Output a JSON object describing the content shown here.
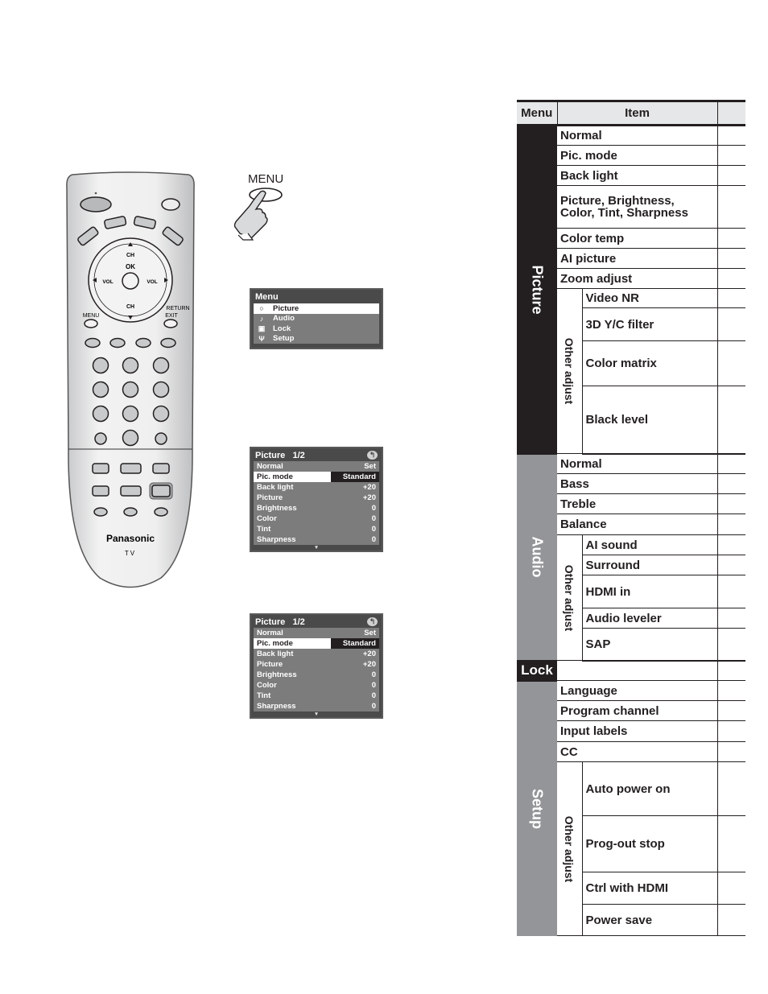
{
  "remote": {
    "brand": "Panasonic",
    "model_label": "TV",
    "buttons": {
      "ch_up": "CH",
      "ch_down": "CH",
      "ok": "OK",
      "vol_left": "VOL",
      "vol_right": "VOL",
      "menu": "MENU",
      "return_top": "RETURN",
      "return_bottom": "EXIT"
    }
  },
  "menu_press": {
    "label": "MENU",
    "icon": "hand-pressing-icon"
  },
  "osd_menu": {
    "title": "Menu",
    "items": [
      {
        "icon": "picture-icon",
        "glyph": "○",
        "label": "Picture",
        "selected": true
      },
      {
        "icon": "music-note-icon",
        "glyph": "♪",
        "label": "Audio",
        "selected": false
      },
      {
        "icon": "lock-icon",
        "glyph": "▣",
        "label": "Lock",
        "selected": false
      },
      {
        "icon": "wrench-icon",
        "glyph": "Ψ",
        "label": "Setup",
        "selected": false
      }
    ]
  },
  "osd_picture_1": {
    "title": "Picture",
    "page": "1/2",
    "return_icon": "↰",
    "rows": [
      {
        "label": "Normal",
        "value": "Set",
        "selected": false
      },
      {
        "label": "Pic. mode",
        "value": "Standard",
        "selected": true
      },
      {
        "label": "Back light",
        "value": "+20",
        "selected": false
      },
      {
        "label": "Picture",
        "value": "+20",
        "selected": false
      },
      {
        "label": "Brightness",
        "value": "0",
        "selected": false
      },
      {
        "label": "Color",
        "value": "0",
        "selected": false
      },
      {
        "label": "Tint",
        "value": "0",
        "selected": false
      },
      {
        "label": "Sharpness",
        "value": "0",
        "selected": false
      }
    ],
    "more_indicator": "▾"
  },
  "osd_picture_2": {
    "title": "Picture",
    "page": "1/2",
    "return_icon": "↰",
    "rows": [
      {
        "label": "Normal",
        "value": "Set",
        "selected": false
      },
      {
        "label": "Pic. mode",
        "value": "Standard",
        "selected": true
      },
      {
        "label": "Back light",
        "value": "+20",
        "selected": false
      },
      {
        "label": "Picture",
        "value": "+20",
        "selected": false
      },
      {
        "label": "Brightness",
        "value": "0",
        "selected": false
      },
      {
        "label": "Color",
        "value": "0",
        "selected": false
      },
      {
        "label": "Tint",
        "value": "0",
        "selected": false
      },
      {
        "label": "Sharpness",
        "value": "0",
        "selected": false
      }
    ],
    "more_indicator": "▾"
  },
  "table": {
    "headers": {
      "menu": "Menu",
      "item": "Item",
      "col3": ""
    },
    "group_label": "Other adjust",
    "sections": {
      "picture": {
        "menu": "Picture",
        "items": [
          "Normal",
          "Pic. mode",
          "Back light",
          "Picture, Brightness,",
          "Color, Tint, Sharpness",
          "Color temp",
          "AI picture",
          "Zoom adjust"
        ],
        "other": [
          "Video NR",
          "3D Y/C filter",
          "Color matrix",
          "Black level"
        ]
      },
      "audio": {
        "menu": "Audio",
        "items": [
          "Normal",
          "Bass",
          "Treble",
          "Balance"
        ],
        "other": [
          "AI sound",
          "Surround",
          "HDMI in",
          "Audio leveler",
          "SAP"
        ]
      },
      "lock": {
        "menu": "Lock"
      },
      "setup": {
        "menu": "Setup",
        "items": [
          "Language",
          "Program channel",
          "Input labels",
          "CC"
        ],
        "other": [
          "Auto power on",
          "Prog-out stop",
          "Ctrl with HDMI",
          "Power save"
        ]
      }
    }
  }
}
